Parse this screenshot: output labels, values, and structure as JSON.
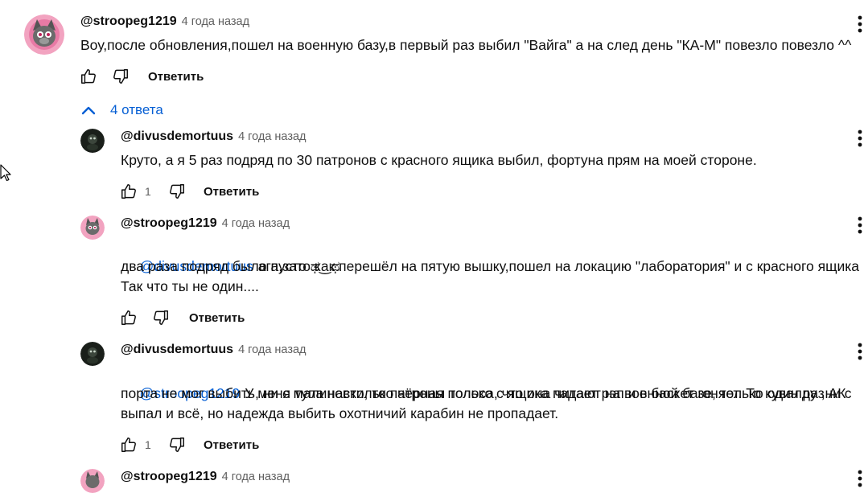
{
  "top_comment": {
    "author": "@stroopeg1219",
    "time": "4 года назад",
    "lines": [
      "Воу,после обновления,пошел на военную базу,в первый раз выбил \"Вайга\" а на след день \"КА-М\" повезло повезло ^^"
    ],
    "reply_label": "Ответить"
  },
  "replies_toggle": {
    "label": "4 ответа"
  },
  "replies": [
    {
      "author": "@divusdemortuus",
      "time": "4 года назад",
      "mention": "",
      "line1": "Круто, а я 5 раз подряд по 30 патронов с красного ящика выбил, фортуна прям на моей стороне.",
      "line2": "",
      "line3": "",
      "likes": "1",
      "reply_label": "Ответить"
    },
    {
      "author": "@stroopeg1219",
      "time": "4 года назад",
      "mention": "@divusdemortuus",
      "line1": "ага,зато как перешёл на пятую вышку,пошел на локацию \"лаборатория\" и с красного ящика",
      "line2": "два раза подряд было пусто ಥ‿ಥ",
      "line3": "Так что ты не один....",
      "likes": "",
      "reply_label": "Ответить"
    },
    {
      "author": "@divusdemortuus",
      "time": "4 года назад",
      "mention": "@stroopeg1219",
      "line1": "У меня тупа настолько чёрная полоса, что она читает рэп и в баскет гоняет. То кувалду ,ни с",
      "line2": "порта не мог выбить, ни с малиновки, то патроны только с ящика падают на военной базе, только один раз АК",
      "line3": "выпал и всё, но надежда выбить охотничий карабин не пропадает.",
      "likes": "1",
      "reply_label": "Ответить"
    },
    {
      "author": "@stroopeg1219",
      "time": "4 года назад"
    }
  ],
  "icons": {
    "like": "thumbs-up-icon",
    "dislike": "thumbs-down-icon",
    "menu": "more-vert-icon",
    "toggle": "chevron-up-icon",
    "cursor": "mouse-pointer-icon"
  },
  "colors": {
    "link": "#065fd4",
    "secondary_text": "#606060",
    "primary_text": "#0f0f0f"
  }
}
